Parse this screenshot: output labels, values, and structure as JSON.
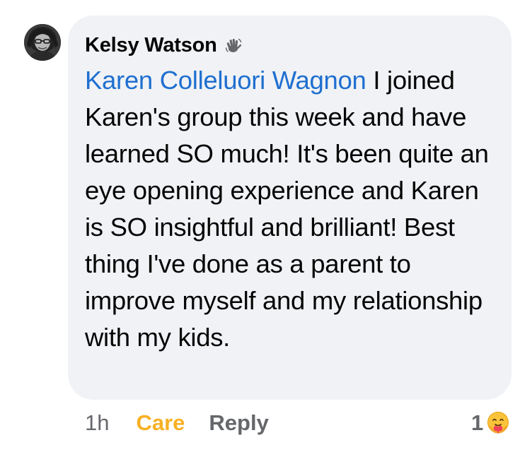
{
  "comment": {
    "author": "Kelsy Watson",
    "badge_icon": "waving-hand-icon",
    "mention": "Karen Colleluori Wagnon",
    "text": " I joined Karen's group this week and have learned SO much! It's been quite an eye opening experience and Karen is SO insightful and brilliant! Best thing I've done as a parent to improve myself and my relationship with my kids."
  },
  "actions": {
    "timestamp": "1h",
    "reaction": "Care",
    "reply": "Reply"
  },
  "reactions": {
    "count": "1",
    "icon": "care-emoji-icon"
  },
  "colors": {
    "bubble": "#f0f2f5",
    "mention": "#1f6fd0",
    "care": "#f7b125",
    "muted": "#65676b"
  }
}
